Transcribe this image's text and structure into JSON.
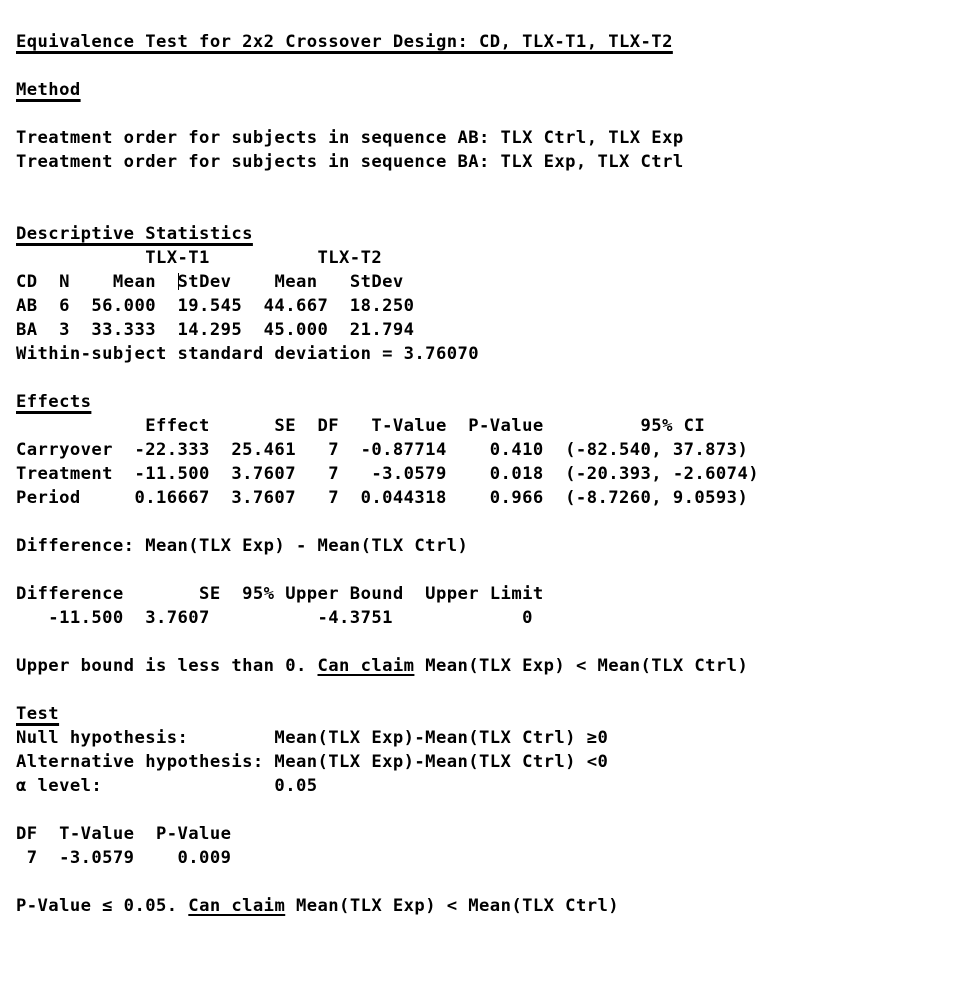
{
  "document": {
    "title": "Equivalence Test for 2x2 Crossover Design: CD, TLX-T1, TLX-T2",
    "background_color": "#ffffff",
    "text_color": "#000000"
  },
  "method": {
    "heading": "Method",
    "lines": [
      "Treatment order for subjects in sequence AB: TLX Ctrl, TLX Exp",
      "Treatment order for subjects in sequence BA: TLX Exp, TLX Ctrl"
    ]
  },
  "descriptive_statistics": {
    "heading": "Descriptive Statistics",
    "group_header": "            TLX-T1          TLX-T2",
    "column_header_left": "CD  N    Mean  ",
    "column_header_right": "StDev    Mean   StDev",
    "rows": [
      "AB  6  56.000  19.545  44.667  18.250",
      "BA  3  33.333  14.295  45.000  21.794"
    ],
    "within_subject_sd": "Within-subject standard deviation = 3.76070"
  },
  "effects": {
    "heading": "Effects",
    "column_header": "            Effect      SE  DF   T-Value  P-Value         95% CI",
    "rows": [
      "Carryover  -22.333  25.461   7  -0.87714    0.410  (-82.540, 37.873)",
      "Treatment  -11.500  3.7607   7   -3.0579    0.018  (-20.393, -2.6074)",
      "Period     0.16667  3.7607   7  0.044318    0.966  (-8.7260, 9.0593)"
    ]
  },
  "difference": {
    "caption": "Difference: Mean(TLX Exp) - Mean(TLX Ctrl)",
    "column_header": "Difference       SE  95% Upper Bound  Upper Limit",
    "row": "   -11.500  3.7607          -4.3751            0",
    "conclusion_prefix": "Upper bound is less than 0. ",
    "conclusion_link": "Can claim",
    "conclusion_suffix": " Mean(TLX Exp) < Mean(TLX Ctrl)"
  },
  "test": {
    "heading": "Test",
    "null_hypothesis": "Null hypothesis:        Mean(TLX Exp)-Mean(TLX Ctrl) ≥0",
    "alternative_hypothesis": "Alternative hypothesis: Mean(TLX Exp)-Mean(TLX Ctrl) <0",
    "alpha_level": "α level:                0.05",
    "column_header": "DF  T-Value  P-Value",
    "row": " 7  -3.0579    0.009",
    "conclusion_prefix": "P-Value ≤ 0.05. ",
    "conclusion_link": "Can claim",
    "conclusion_suffix": " Mean(TLX Exp) < Mean(TLX Ctrl)"
  }
}
